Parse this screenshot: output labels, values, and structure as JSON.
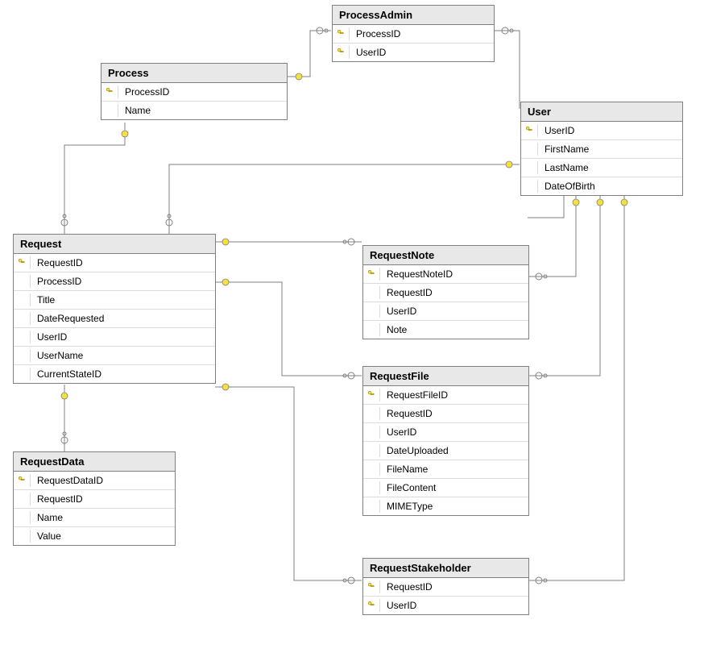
{
  "diagram_type": "entity-relationship",
  "tables": {
    "processAdmin": {
      "name": "ProcessAdmin",
      "columns": [
        {
          "name": "ProcessID",
          "pk": true
        },
        {
          "name": "UserID",
          "pk": true
        }
      ]
    },
    "process": {
      "name": "Process",
      "columns": [
        {
          "name": "ProcessID",
          "pk": true
        },
        {
          "name": "Name",
          "pk": false
        }
      ]
    },
    "user": {
      "name": "User",
      "columns": [
        {
          "name": "UserID",
          "pk": true
        },
        {
          "name": "FirstName",
          "pk": false
        },
        {
          "name": "LastName",
          "pk": false
        },
        {
          "name": "DateOfBirth",
          "pk": false
        }
      ]
    },
    "request": {
      "name": "Request",
      "columns": [
        {
          "name": "RequestID",
          "pk": true
        },
        {
          "name": "ProcessID",
          "pk": false
        },
        {
          "name": "Title",
          "pk": false
        },
        {
          "name": "DateRequested",
          "pk": false
        },
        {
          "name": "UserID",
          "pk": false
        },
        {
          "name": "UserName",
          "pk": false
        },
        {
          "name": "CurrentStateID",
          "pk": false
        }
      ]
    },
    "requestNote": {
      "name": "RequestNote",
      "columns": [
        {
          "name": "RequestNoteID",
          "pk": true
        },
        {
          "name": "RequestID",
          "pk": false
        },
        {
          "name": "UserID",
          "pk": false
        },
        {
          "name": "Note",
          "pk": false
        }
      ]
    },
    "requestFile": {
      "name": "RequestFile",
      "columns": [
        {
          "name": "RequestFileID",
          "pk": true
        },
        {
          "name": "RequestID",
          "pk": false
        },
        {
          "name": "UserID",
          "pk": false
        },
        {
          "name": "DateUploaded",
          "pk": false
        },
        {
          "name": "FileName",
          "pk": false
        },
        {
          "name": "FileContent",
          "pk": false
        },
        {
          "name": "MIMEType",
          "pk": false
        }
      ]
    },
    "requestData": {
      "name": "RequestData",
      "columns": [
        {
          "name": "RequestDataID",
          "pk": true
        },
        {
          "name": "RequestID",
          "pk": false
        },
        {
          "name": "Name",
          "pk": false
        },
        {
          "name": "Value",
          "pk": false
        }
      ]
    },
    "requestStakeholder": {
      "name": "RequestStakeholder",
      "columns": [
        {
          "name": "RequestID",
          "pk": true
        },
        {
          "name": "UserID",
          "pk": true
        }
      ]
    }
  },
  "relationships": [
    {
      "from": "ProcessAdmin.ProcessID",
      "to": "Process.ProcessID"
    },
    {
      "from": "ProcessAdmin.UserID",
      "to": "User.UserID"
    },
    {
      "from": "Request.ProcessID",
      "to": "Process.ProcessID"
    },
    {
      "from": "Request.UserID",
      "to": "User.UserID"
    },
    {
      "from": "RequestNote.RequestID",
      "to": "Request.RequestID"
    },
    {
      "from": "RequestNote.UserID",
      "to": "User.UserID"
    },
    {
      "from": "RequestFile.RequestID",
      "to": "Request.RequestID"
    },
    {
      "from": "RequestFile.UserID",
      "to": "User.UserID"
    },
    {
      "from": "RequestData.RequestID",
      "to": "Request.RequestID"
    },
    {
      "from": "RequestStakeholder.RequestID",
      "to": "Request.RequestID"
    },
    {
      "from": "RequestStakeholder.UserID",
      "to": "User.UserID"
    }
  ]
}
